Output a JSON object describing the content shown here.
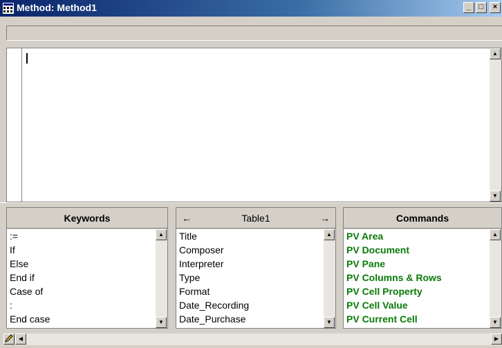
{
  "window": {
    "title": "Method: Method1",
    "minimize_icon": "minimize-icon",
    "maximize_icon": "maximize-icon",
    "close_icon": "close-icon"
  },
  "keywords": {
    "header": "Keywords",
    "items": [
      ":=",
      "If",
      "Else",
      "End if",
      "Case of",
      ":",
      "End case"
    ]
  },
  "tables": {
    "header": "Table1",
    "prev_icon": "left-arrow-icon",
    "next_icon": "right-arrow-icon",
    "items": [
      "Title",
      "Composer",
      "Interpreter",
      "Type",
      "Format",
      "Date_Recording",
      "Date_Purchase"
    ]
  },
  "commands": {
    "header": "Commands",
    "color": "#087a08",
    "items": [
      "PV Area",
      "PV Document",
      "PV Pane",
      "PV Columns & Rows",
      "PV Cell Property",
      "PV Cell Value",
      "PV Current Cell"
    ]
  },
  "statusbar": {
    "pencil_icon": "pencil-icon"
  }
}
